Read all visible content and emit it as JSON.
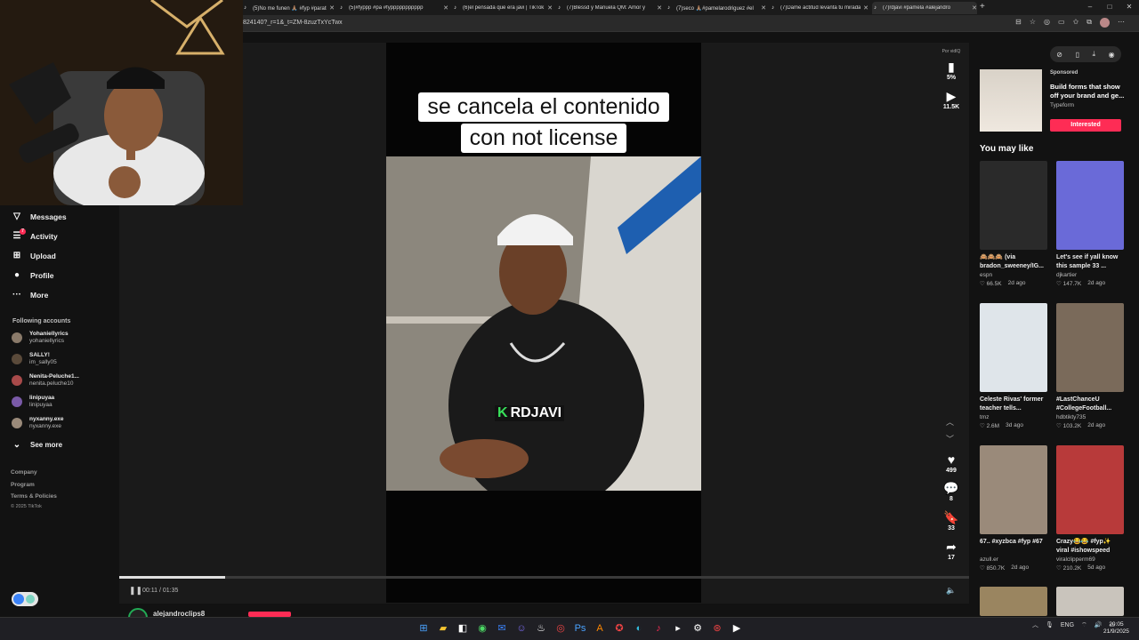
{
  "browser": {
    "tabs": [
      {
        "icon": "tiktok-icon",
        "title": "(5)No me funen 🙏🏽 #fyp #parati",
        "active": false
      },
      {
        "icon": "tiktok-icon",
        "title": "(5)#fyppp #pa #fyppppppppppp",
        "active": false
      },
      {
        "icon": "tiktok-icon",
        "title": "(6)el pensada que era javi | TikTok",
        "active": false
      },
      {
        "icon": "tiktok-icon",
        "title": "(7)Blessd y Manuela QM: Amor y",
        "active": false
      },
      {
        "icon": "tiktok-icon",
        "title": "(7)seco 🙏🏽#pamelarodriguez #el",
        "active": false
      },
      {
        "icon": "tiktok-icon",
        "title": "(7)Dame actitud levanta tu mirada",
        "active": false
      },
      {
        "icon": "tiktok-icon",
        "title": "(7)rdjavi #pamela #alejandro",
        "active": true
      }
    ],
    "new_tab": "+",
    "url": "824140?_r=1&_t=ZM-8zuzTxYcTwx"
  },
  "sidebar": {
    "nav": [
      {
        "icon": "messages-icon",
        "glyph": "▽",
        "label": "Messages"
      },
      {
        "icon": "activity-icon",
        "glyph": "☰",
        "label": "Activity",
        "badge": "7"
      },
      {
        "icon": "upload-icon",
        "glyph": "⊞",
        "label": "Upload"
      },
      {
        "icon": "profile-icon",
        "glyph": "●",
        "label": "Profile"
      },
      {
        "icon": "more-icon",
        "glyph": "···",
        "label": "More"
      }
    ],
    "following_title": "Following accounts",
    "following": [
      {
        "name": "Yohaniellyrics",
        "handle": "yohaniellyrics",
        "color": "#8a7a6a"
      },
      {
        "name": "SALLY!",
        "handle": "im_sally05",
        "color": "#5a4a3a"
      },
      {
        "name": "Nenita-Peluche1...",
        "handle": "nenita.peluche10",
        "color": "#a84a4a"
      },
      {
        "name": "linipuyaa",
        "handle": "linipuyaa",
        "color": "#7a5aa8"
      },
      {
        "name": "nyxanny.exe",
        "handle": "nyxanny.exe",
        "color": "#9a8a7a"
      }
    ],
    "see_more": "See more",
    "footer": [
      "Company",
      "Program",
      "Terms & Policies",
      "© 2025 TikTok"
    ]
  },
  "video": {
    "caption_lines": [
      "se cancela el contenido",
      "con not license"
    ],
    "watermark": "RDJAVI",
    "watermark_k": "K",
    "time": "00:11 / 01:35",
    "progress": 0.125,
    "creator": "alejandroclips8",
    "powered_by": "Por vidIQ"
  },
  "rail": {
    "stats_percent": "5%",
    "views": "11.5K",
    "likes": "499",
    "comments": "8",
    "saves": "33",
    "shares": "17"
  },
  "ad": {
    "sponsored": "Sponsored",
    "title": "Build forms that show off your brand and ge...",
    "brand": "Typeform",
    "cta": "Interested"
  },
  "you_may_like": "You may like",
  "recs": [
    {
      "title": "🙈🙈🙈 (via bradon_sweeney/IG...",
      "author": "espn",
      "views": "66.5K",
      "age": "2d ago",
      "color": "#2a2a2a"
    },
    {
      "title": "Let's see if yall know this sample 33 ...",
      "author": "djkartier",
      "views": "147.7K",
      "age": "2d ago",
      "color": "#6a6ad8"
    },
    {
      "title": "Celeste Rivas' former teacher tells...",
      "author": "tmz",
      "views": "2.6M",
      "age": "3d ago",
      "color": "#dfe5ea"
    },
    {
      "title": "#LastChanceU #CollegeFootball...",
      "author": "hdbtikty735",
      "views": "103.2K",
      "age": "2d ago",
      "color": "#7a6a5a"
    },
    {
      "title": "67.. #xyzbca #fyp #67",
      "author": "azull.er",
      "views": "850.7K",
      "age": "2d ago",
      "color": "#9a8a7a"
    },
    {
      "title": "Crazy😂😂 #fyp✨ viral #ishowspeed",
      "author": "viralclipperm69",
      "views": "210.2K",
      "age": "5d ago",
      "color": "#b83a3a"
    }
  ],
  "taskbar": {
    "lang": "ENG",
    "time": "20:05",
    "date": "21/9/2025"
  },
  "colors": {
    "accent": "#fe2c55",
    "bg": "#121212"
  }
}
